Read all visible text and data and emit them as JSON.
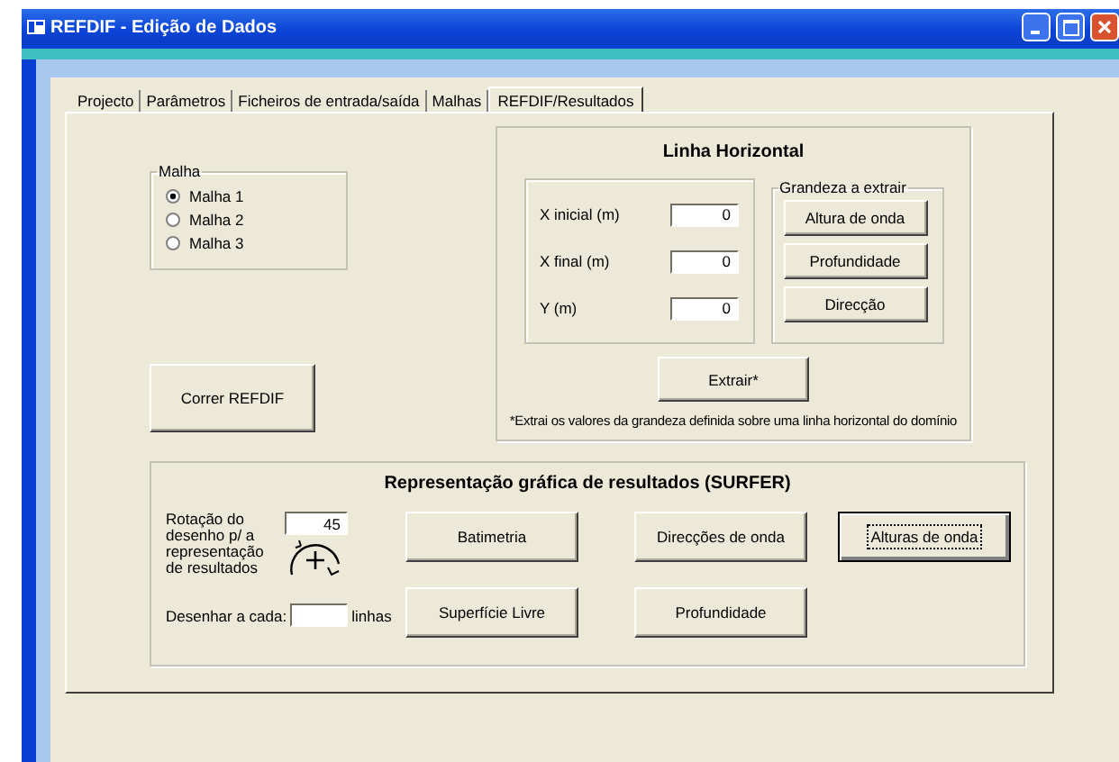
{
  "window": {
    "title": "REFDIF - Edição de Dados"
  },
  "tabs": [
    {
      "label": "Projecto",
      "selected": false
    },
    {
      "label": "Parâmetros",
      "selected": false
    },
    {
      "label": "Ficheiros de entrada/saída",
      "selected": false
    },
    {
      "label": "Malhas",
      "selected": false
    },
    {
      "label": "REFDIF/Resultados",
      "selected": true
    }
  ],
  "malha": {
    "title": "Malha",
    "options": [
      {
        "label": "Malha 1",
        "selected": true
      },
      {
        "label": "Malha 2",
        "selected": false
      },
      {
        "label": "Malha 3",
        "selected": false
      }
    ]
  },
  "run_button": "Correr REFDIF",
  "linha_horizontal": {
    "title": "Linha Horizontal",
    "fields": [
      {
        "label": "X inicial (m)",
        "value": "0"
      },
      {
        "label": "X final (m)",
        "value": "0"
      },
      {
        "label": "Y (m)",
        "value": "0"
      }
    ],
    "grandeza": {
      "title": "Grandeza a extrair",
      "buttons": [
        "Altura de onda",
        "Profundidade",
        "Direcção"
      ]
    },
    "extract_button": "Extrair*",
    "note": "*Extrai os valores da grandeza definida sobre uma linha horizontal do domínio"
  },
  "surfer": {
    "title": "Representação gráfica de resultados (SURFER)",
    "rotation_label": "Rotação do desenho p/ a representação de resultados",
    "rotation_value": "45",
    "every_label": "Desenhar a cada:",
    "every_unit": "linhas",
    "buttons": [
      {
        "label": "Batimetria",
        "focused": false
      },
      {
        "label": "Direcções de onda",
        "focused": false
      },
      {
        "label": "Alturas de onda",
        "focused": true
      },
      {
        "label": "Superfície Livre",
        "focused": false
      },
      {
        "label": "Profundidade",
        "focused": false
      }
    ]
  }
}
